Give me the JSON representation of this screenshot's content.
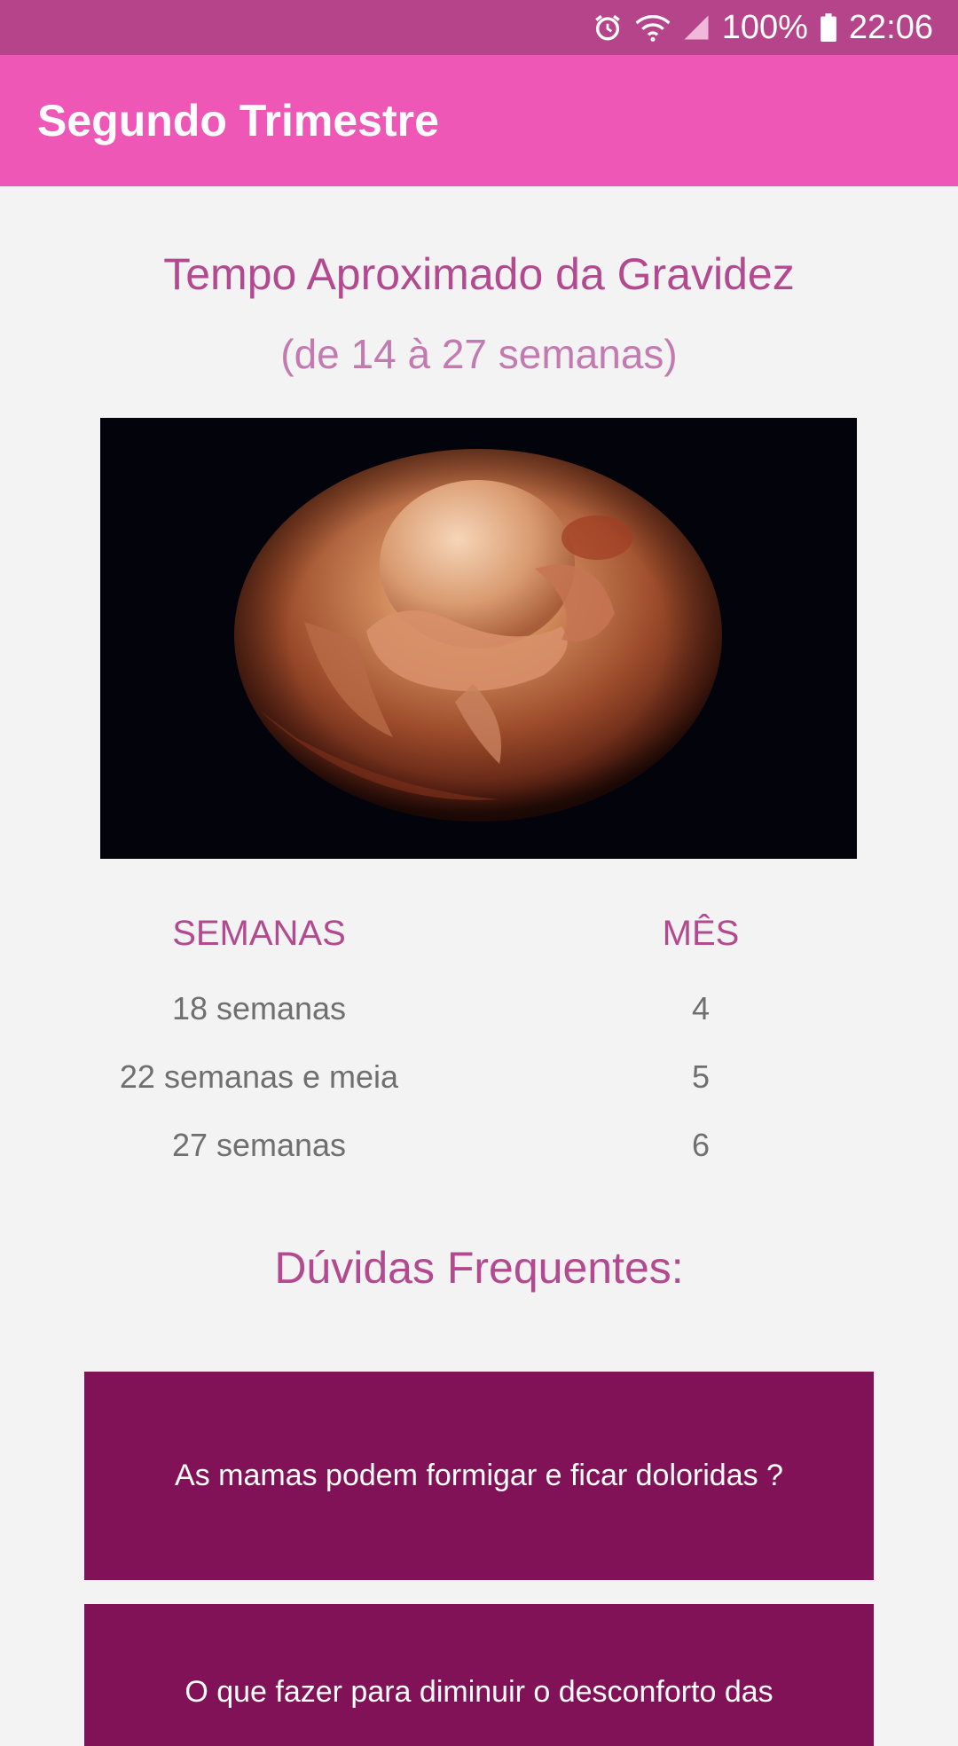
{
  "status_bar": {
    "battery": "100%",
    "time": "22:06"
  },
  "app_bar": {
    "title": "Segundo Trimestre"
  },
  "header": {
    "title": "Tempo Aproximado da Gravidez",
    "subtitle": "(de 14 à 27 semanas)"
  },
  "table": {
    "headers": [
      "SEMANAS",
      "MÊS"
    ],
    "rows": [
      [
        "18 semanas",
        "4"
      ],
      [
        "22 semanas e meia",
        "5"
      ],
      [
        "27 semanas",
        "6"
      ]
    ]
  },
  "faq": {
    "title": "Dúvidas Frequentes:",
    "items": [
      {
        "question": "As mamas podem formigar e ficar doloridas ?"
      },
      {
        "question": "O que fazer para diminuir o desconforto das"
      }
    ]
  },
  "colors": {
    "status_bar": "#b5448b",
    "app_bar": "#ee57b5",
    "accent_text": "#b34a90",
    "card": "#821257"
  }
}
